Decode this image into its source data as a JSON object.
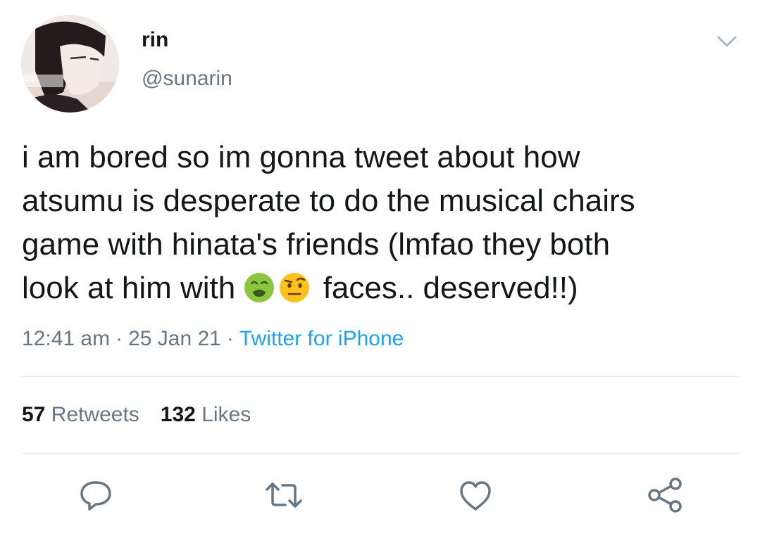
{
  "user": {
    "display_name": "rin",
    "handle": "@sunarin"
  },
  "tweet": {
    "text_lines": [
      "i am bored so im gonna tweet about how",
      "atsumu is desperate to do the musical chairs",
      "game with hinata's friends (lmfao they both",
      "look at him with"
    ],
    "text_after_emoji": "faces.. deserved!!)",
    "emojis": [
      "nauseated-face-emoji",
      "face-with-raised-eyebrow-emoji"
    ],
    "time": "12:41 am",
    "date": "25 Jan 21",
    "separator": "·",
    "source": "Twitter for iPhone"
  },
  "stats": {
    "retweets_count": "57",
    "retweets_label": "Retweets",
    "likes_count": "132",
    "likes_label": "Likes"
  },
  "actions": [
    "reply-icon",
    "retweet-icon",
    "like-icon",
    "share-icon"
  ],
  "colors": {
    "text": "#14171a",
    "secondary": "#657786",
    "link": "#1da1f2",
    "divider": "#e1e8ed"
  }
}
